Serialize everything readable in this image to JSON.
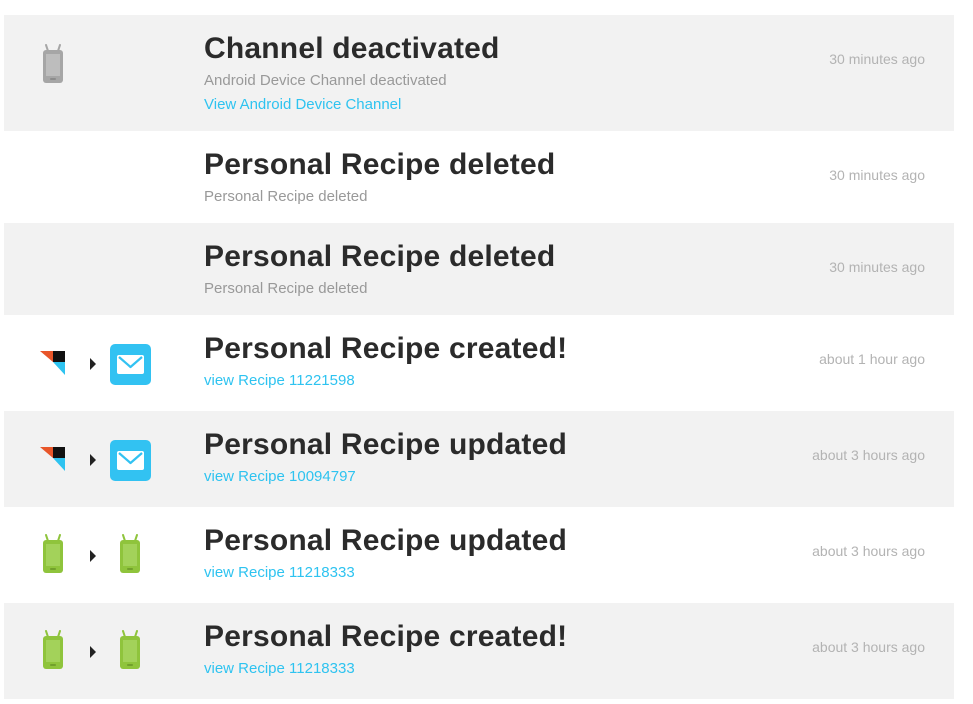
{
  "colors": {
    "row_alt_bg": "#f2f2f2",
    "title": "#2b2b2b",
    "subtitle": "#999999",
    "link": "#2ec3f0",
    "timestamp": "#b3b3b3",
    "android_green": "#8fc43c",
    "android_gray": "#a6a6a6",
    "email_blue": "#32c2f2"
  },
  "feed": [
    {
      "title": "Channel deactivated",
      "subtitle": "Android Device Channel deactivated",
      "link": "View Android Device Channel",
      "time": "30 minutes ago",
      "icons": [
        "android-device-gray-icon"
      ]
    },
    {
      "title": "Personal Recipe deleted",
      "subtitle": "Personal Recipe deleted",
      "time": "30 minutes ago",
      "icons": []
    },
    {
      "title": "Personal Recipe deleted",
      "subtitle": "Personal Recipe deleted",
      "time": "30 minutes ago",
      "icons": []
    },
    {
      "title": "Personal Recipe created!",
      "link": "view Recipe 11221598",
      "time": "about 1 hour ago",
      "icons": [
        "delicious-logo-icon",
        "arrow-right-icon",
        "email-channel-icon"
      ]
    },
    {
      "title": "Personal Recipe updated",
      "link": "view Recipe 10094797",
      "time": "about 3 hours ago",
      "icons": [
        "delicious-logo-icon",
        "arrow-right-icon",
        "email-channel-icon"
      ]
    },
    {
      "title": "Personal Recipe updated",
      "link": "view Recipe 11218333",
      "time": "about 3 hours ago",
      "icons": [
        "android-device-green-icon",
        "arrow-right-icon",
        "android-device-green-icon"
      ]
    },
    {
      "title": "Personal Recipe created!",
      "link": "view Recipe 11218333",
      "time": "about 3 hours ago",
      "icons": [
        "android-device-green-icon",
        "arrow-right-icon",
        "android-device-green-icon"
      ]
    }
  ]
}
